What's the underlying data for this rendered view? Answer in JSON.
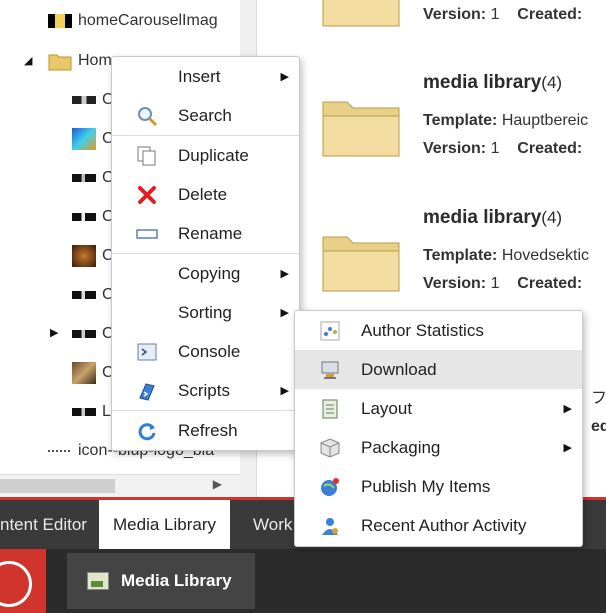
{
  "tree": {
    "rows": [
      {
        "label": "homeCarouselImag"
      },
      {
        "label": "Hom"
      },
      {
        "label": "C"
      },
      {
        "label": "C"
      },
      {
        "label": "C"
      },
      {
        "label": "C"
      },
      {
        "label": "C"
      },
      {
        "label": "C"
      },
      {
        "label": "C"
      },
      {
        "label": "C"
      },
      {
        "label": "L"
      },
      {
        "label": "icon--blup-logo_bla"
      }
    ]
  },
  "content": {
    "items": [
      {
        "title": "",
        "count": "",
        "template_label": "",
        "template": "",
        "version_label": "Version:",
        "version": "1",
        "created_label": "Created:"
      },
      {
        "title": "media library",
        "count": "(4)",
        "template_label": "Template:",
        "template": "Hauptbereic",
        "version_label": "Version:",
        "version": "1",
        "created_label": "Created:"
      },
      {
        "title": "media library",
        "count": "(4)",
        "template_label": "Template:",
        "template": "Hovedsektic",
        "version_label": "Version:",
        "version": "1",
        "created_label": "Created:"
      }
    ],
    "partial_1": "フ",
    "partial_2": "ed:"
  },
  "context_menu": {
    "items": [
      {
        "label": "Insert",
        "icon": "none",
        "submenu": true
      },
      {
        "label": "Search",
        "icon": "search-icon",
        "submenu": false
      },
      {
        "label": "Duplicate",
        "icon": "duplicate-icon",
        "submenu": false
      },
      {
        "label": "Delete",
        "icon": "delete-icon",
        "submenu": false
      },
      {
        "label": "Rename",
        "icon": "rename-icon",
        "submenu": false
      },
      {
        "label": "Copying",
        "icon": "none",
        "submenu": true
      },
      {
        "label": "Sorting",
        "icon": "none",
        "submenu": true
      },
      {
        "label": "Console",
        "icon": "console-icon",
        "submenu": false
      },
      {
        "label": "Scripts",
        "icon": "scripts-icon",
        "submenu": true
      },
      {
        "label": "Refresh",
        "icon": "refresh-icon",
        "submenu": false
      }
    ]
  },
  "submenu": {
    "items": [
      {
        "label": "Author Statistics",
        "icon": "author-statistics-icon",
        "submenu": false
      },
      {
        "label": "Download",
        "icon": "download-icon",
        "submenu": false,
        "highlighted": true
      },
      {
        "label": "Layout",
        "icon": "layout-icon",
        "submenu": true
      },
      {
        "label": "Packaging",
        "icon": "packaging-icon",
        "submenu": true
      },
      {
        "label": "Publish My Items",
        "icon": "publish-icon",
        "submenu": false
      },
      {
        "label": "Recent Author Activity",
        "icon": "recent-activity-icon",
        "submenu": false
      }
    ]
  },
  "tabs": [
    {
      "label": "ntent Editor"
    },
    {
      "label": "Media Library",
      "active": true
    },
    {
      "label": "Work"
    }
  ],
  "taskbar": {
    "item_label": "Media Library"
  },
  "colors": {
    "accent_red": "#d0342c",
    "tabbar": "#3a3a3a",
    "taskbar": "#2b2b2b",
    "highlight": "#e6e6e6"
  }
}
